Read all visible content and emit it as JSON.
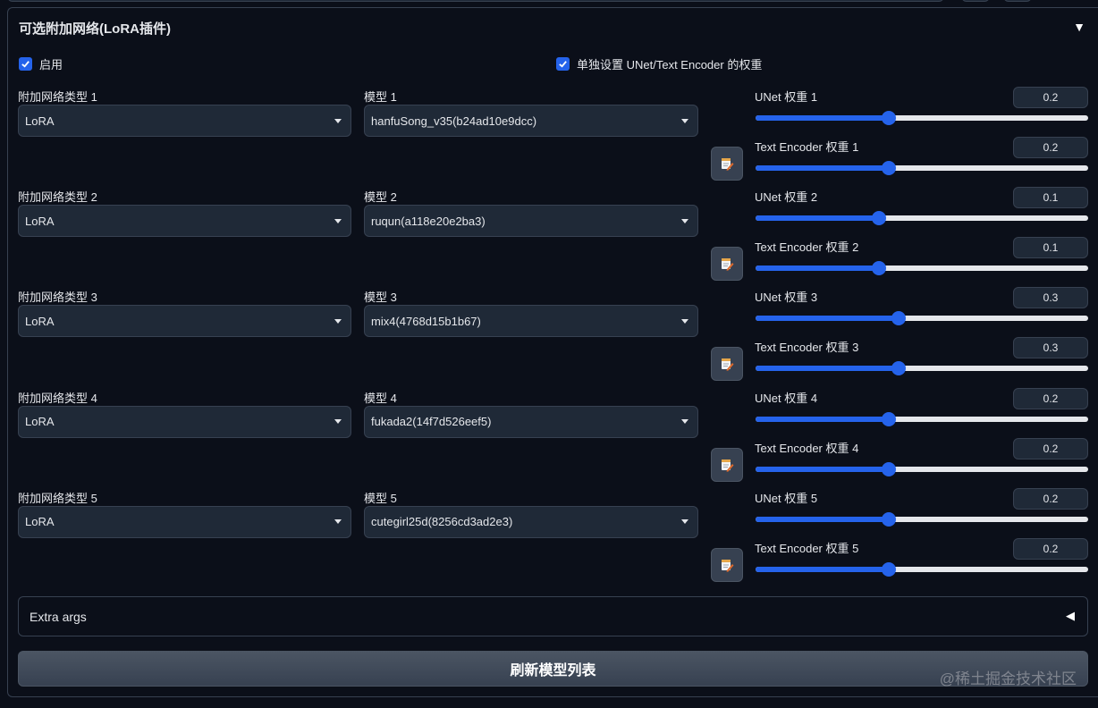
{
  "panel": {
    "title": "可选附加网络(LoRA插件)",
    "collapse_icon": "▼"
  },
  "checkboxes": {
    "enable": {
      "label": "启用",
      "checked": true
    },
    "separate_weights": {
      "label": "单独设置 UNet/Text Encoder 的权重",
      "checked": true
    }
  },
  "rows": [
    {
      "type_label": "附加网络类型 1",
      "type_value": "LoRA",
      "model_label": "模型 1",
      "model_value": "hanfuSong_v35(b24ad10e9dcc)",
      "unet_label": "UNet 权重 1",
      "unet_value": "0.2",
      "unet_level": 0.4,
      "te_label": "Text Encoder 权重 1",
      "te_value": "0.2",
      "te_level": 0.4
    },
    {
      "type_label": "附加网络类型 2",
      "type_value": "LoRA",
      "model_label": "模型 2",
      "model_value": "ruqun(a118e20e2ba3)",
      "unet_label": "UNet 权重 2",
      "unet_value": "0.1",
      "unet_level": 0.37,
      "te_label": "Text Encoder 权重 2",
      "te_value": "0.1",
      "te_level": 0.37
    },
    {
      "type_label": "附加网络类型 3",
      "type_value": "LoRA",
      "model_label": "模型 3",
      "model_value": "mix4(4768d15b1b67)",
      "unet_label": "UNet 权重 3",
      "unet_value": "0.3",
      "unet_level": 0.43,
      "te_label": "Text Encoder 权重 3",
      "te_value": "0.3",
      "te_level": 0.43
    },
    {
      "type_label": "附加网络类型 4",
      "type_value": "LoRA",
      "model_label": "模型 4",
      "model_value": "fukada2(14f7d526eef5)",
      "unet_label": "UNet 权重 4",
      "unet_value": "0.2",
      "unet_level": 0.4,
      "te_label": "Text Encoder 权重 4",
      "te_value": "0.2",
      "te_level": 0.4
    },
    {
      "type_label": "附加网络类型 5",
      "type_value": "LoRA",
      "model_label": "模型 5",
      "model_value": "cutegirl25d(8256cd3ad2e3)",
      "unet_label": "UNet 权重 5",
      "unet_value": "0.2",
      "unet_level": 0.4,
      "te_label": "Text Encoder 权重 5",
      "te_value": "0.2",
      "te_level": 0.4
    }
  ],
  "extra_args": {
    "label": "Extra args",
    "icon": "◀"
  },
  "refresh_button": {
    "label": "刷新模型列表"
  },
  "watermark": "@稀土掘金技术社区",
  "colors": {
    "accent": "#2563eb",
    "background": "#0b0f19",
    "input_bg": "#1f2937",
    "border": "#374151"
  }
}
